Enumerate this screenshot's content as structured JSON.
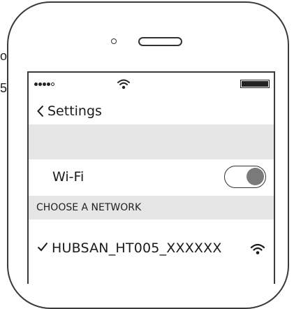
{
  "clipped_left_text": {
    "line1": "o",
    "line2": "5"
  },
  "status_bar": {
    "signal_icon": "signal-dots-icon",
    "wifi_icon": "wifi-icon",
    "battery_icon": "battery-icon"
  },
  "nav": {
    "back_label": "Settings",
    "back_icon": "chevron-left-icon"
  },
  "wifi_setting": {
    "label": "Wi-Fi",
    "enabled": true
  },
  "section": {
    "header": "CHOOSE A NETWORK"
  },
  "network": {
    "name": "HUBSAN_HT005_XXXXXX",
    "selected": true,
    "check_icon": "checkmark-icon",
    "signal_icon": "wifi-icon"
  }
}
